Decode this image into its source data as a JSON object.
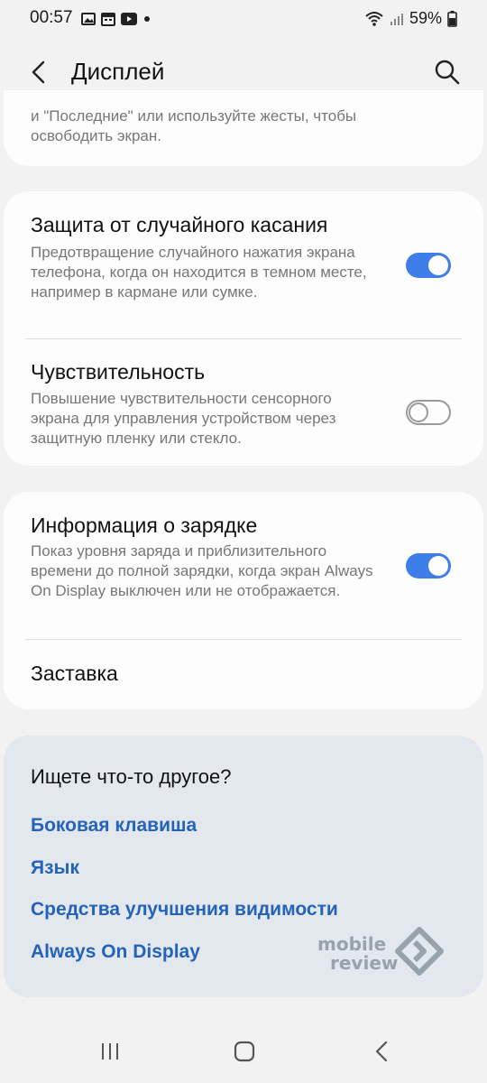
{
  "status_bar": {
    "time": "00:57",
    "battery": "59%",
    "icons": [
      "gallery-icon",
      "calendar-icon",
      "youtube-icon",
      "dot-icon",
      "wifi-icon",
      "signal-icon",
      "battery-icon"
    ]
  },
  "header": {
    "title": "Дисплей"
  },
  "partial_card": {
    "text": "и \"Последние\" или используйте жесты, чтобы освободить экран."
  },
  "settings": [
    {
      "title": "Защита от случайного касания",
      "description": "Предотвращение случайного нажатия экрана телефона, когда он находится в темном месте, например в кармане или сумке.",
      "enabled": true
    },
    {
      "title": "Чувствительность",
      "description": "Повышение чувствительности сенсорного экрана для управления устройством через защитную пленку или стекло.",
      "enabled": false
    },
    {
      "title": "Информация о зарядке",
      "description": "Показ уровня заряда и приблизительного времени до полной зарядки, когда экран Always On Display выключен или не отображается.",
      "enabled": true
    },
    {
      "title": "Заставка"
    }
  ],
  "suggestions": {
    "title": "Ищете что-то другое?",
    "links": [
      "Боковая клавиша",
      "Язык",
      "Средства улучшения видимости",
      "Always On Display"
    ]
  },
  "watermark": {
    "line1": "mobile",
    "line2": "review"
  },
  "colors": {
    "accent": "#3e7ee8",
    "link": "#2463b8",
    "background": "#f2f2f2",
    "card": "#fdfdfd",
    "suggest_bg": "#e3e8ee"
  }
}
